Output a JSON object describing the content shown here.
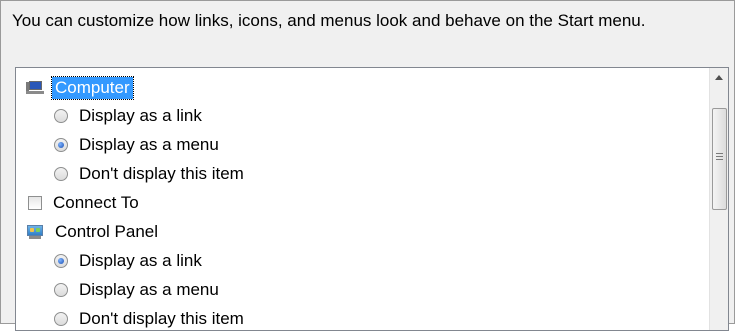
{
  "description": "You can customize how links, icons, and menus look and behave on the Start menu.",
  "items": [
    {
      "label": "Computer",
      "type": "header",
      "icon": "computer-icon",
      "selected": true
    },
    {
      "label": "Display as a link",
      "type": "radio",
      "checked": false
    },
    {
      "label": "Display as a menu",
      "type": "radio",
      "checked": true
    },
    {
      "label": "Don't display this item",
      "type": "radio",
      "checked": false
    },
    {
      "label": "Connect To",
      "type": "checkbox",
      "checked": false
    },
    {
      "label": "Control Panel",
      "type": "header",
      "icon": "control-panel-icon",
      "selected": false
    },
    {
      "label": "Display as a link",
      "type": "radio",
      "checked": true
    },
    {
      "label": "Display as a menu",
      "type": "radio",
      "checked": false
    },
    {
      "label": "Don't display this item",
      "type": "radio",
      "checked": false
    }
  ],
  "colors": {
    "selection": "#3399ff",
    "border": "#828790"
  }
}
